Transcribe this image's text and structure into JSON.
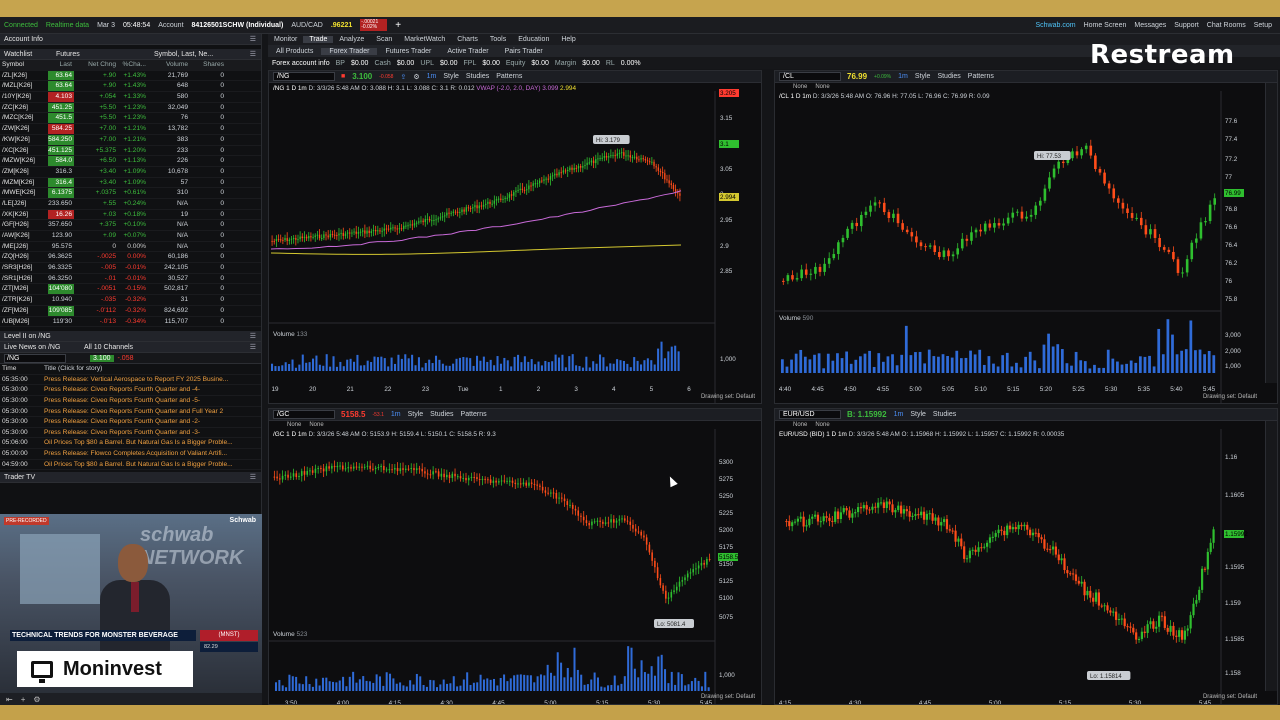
{
  "status": {
    "connected": "Connected",
    "realtime": "Realtime data",
    "date": "Mar 3",
    "time": "05:48:54",
    "account_label": "Account",
    "account": "84126501SCHW (Individual)",
    "audcad_sym": "AUD/CAD",
    "audcad_price": ".96221",
    "audcad_chg": "-.00021",
    "audcad_pct": "-0.02%",
    "schwab": "Schwab.com",
    "home": "Home Screen",
    "messages": "Messages",
    "support": "Support",
    "chat": "Chat Rooms",
    "setup": "Setup",
    "ondemand": "OnDemand"
  },
  "overlay": {
    "restream": "Restream",
    "moninvest": "Moninvest"
  },
  "left": {
    "account_info": "Account Info",
    "watchlist": "Watchlist",
    "watchlist_name": "Futures",
    "symbol_search": "Symbol, Last, Ne...",
    "cols": [
      "Symbol",
      "Last",
      "Net Chng",
      "%Cha...",
      "Volume",
      "Shares"
    ],
    "rows": [
      [
        "/ZL[K26]",
        "63.64",
        "+.90",
        "+1.43%",
        "21,769",
        "0",
        "up"
      ],
      [
        "/MZL[K26]",
        "63.64",
        "+.90",
        "+1.43%",
        "648",
        "0",
        "up"
      ],
      [
        "/10Y[K26]",
        "4.103",
        "+.054",
        "+1.33%",
        "580",
        "0",
        "dn"
      ],
      [
        "/ZC[K26]",
        "451.25",
        "+5.50",
        "+1.23%",
        "32,049",
        "0",
        "up"
      ],
      [
        "/MZC[K26]",
        "451.5",
        "+5.50",
        "+1.23%",
        "76",
        "0",
        "up"
      ],
      [
        "/ZW[K26]",
        "584.25",
        "+7.00",
        "+1.21%",
        "13,782",
        "0",
        "dn"
      ],
      [
        "/KW[K26]",
        "584.250",
        "+7.00",
        "+1.21%",
        "383",
        "0",
        "up"
      ],
      [
        "/XC[K26]",
        "451.125",
        "+5.375",
        "+1.20%",
        "233",
        "0",
        "up"
      ],
      [
        "/MZW[K26]",
        "584.0",
        "+6.50",
        "+1.13%",
        "226",
        "0",
        "up"
      ],
      [
        "/ZM[K26]",
        "316.3",
        "+3.40",
        "+1.09%",
        "10,678",
        "0",
        "none"
      ],
      [
        "/MZM[K26]",
        "316.4",
        "+3.40",
        "+1.09%",
        "57",
        "0",
        "up"
      ],
      [
        "/MWE[K26]",
        "6.1375",
        "+.0375",
        "+0.61%",
        "310",
        "0",
        "up"
      ],
      [
        "/LE[J26]",
        "233.650",
        "+.55",
        "+0.24%",
        "N/A",
        "0",
        "none"
      ],
      [
        "/XK[K26]",
        "16.26",
        "+.03",
        "+0.18%",
        "19",
        "0",
        "dn"
      ],
      [
        "/GF[H26]",
        "357.650",
        "+.375",
        "+0.10%",
        "N/A",
        "0",
        "none"
      ],
      [
        "/AW[K26]",
        "123.90",
        "+.09",
        "+0.07%",
        "N/A",
        "0",
        "none"
      ],
      [
        "/ME[J26]",
        "95.575",
        "0",
        "0.00%",
        "N/A",
        "0",
        "none"
      ],
      [
        "/ZQ[H26]",
        "96.3625",
        "-.0025",
        "0.00%",
        "60,186",
        "0",
        "none"
      ],
      [
        "/SR3[H26]",
        "96.3325",
        "-.005",
        "-0.01%",
        "242,105",
        "0",
        "none"
      ],
      [
        "/SR1[H26]",
        "96.3250",
        "-.01",
        "-0.01%",
        "30,527",
        "0",
        "none"
      ],
      [
        "/ZT[M26]",
        "104'080",
        "-.0051",
        "-0.15%",
        "502,817",
        "0",
        "up"
      ],
      [
        "/ZTR[K26]",
        "10.940",
        "-.035",
        "-0.32%",
        "31",
        "0",
        "none"
      ],
      [
        "/ZF[M26]",
        "109'085",
        "-.0'112",
        "-0.32%",
        "824,692",
        "0",
        "up"
      ],
      [
        "/UB[M26]",
        "119'30",
        "-.0'13",
        "-0.34%",
        "115,707",
        "0",
        "none"
      ]
    ],
    "level2": "Level II on /NG",
    "live_news": "Live News on /NG",
    "news_filter": "All 10 Channels",
    "news_sym": "/NG",
    "news_price": "3.100",
    "news_chg": "-.058",
    "news_cols": [
      "Time",
      "Title (Click for story)"
    ],
    "news": [
      [
        "05:35:00",
        "Press Release: Vertical Aerospace to Report FY 2025 Busine..."
      ],
      [
        "05:30:00",
        "Press Release: Civeo Reports Fourth Quarter and -4-"
      ],
      [
        "05:30:00",
        "Press Release: Civeo Reports Fourth Quarter and -5-"
      ],
      [
        "05:30:00",
        "Press Release: Civeo Reports Fourth Quarter and Full Year 2"
      ],
      [
        "05:30:00",
        "Press Release: Civeo Reports Fourth Quarter and -2-"
      ],
      [
        "05:30:00",
        "Press Release: Civeo Reports Fourth Quarter and -3-"
      ],
      [
        "05:06:00",
        "Oil Prices Top $80 a Barrel. But Natural Gas Is a Bigger Proble..."
      ],
      [
        "05:00:00",
        "Press Release: Flowco Completes Acquisition of Valiant Artifi..."
      ],
      [
        "04:59:00",
        "Oil Prices Top $80 a Barrel. But Natural Gas Is a Bigger Proble..."
      ]
    ],
    "trader_tv": "Trader TV",
    "tv": {
      "badge": "PRE-RECORDED",
      "logo": "Schwab",
      "sign": "schwab NETWORK",
      "caption": "TECHNICAL TRENDS FOR MONSTER BEVERAGE",
      "ticker": "(MNST)",
      "price": "82.29"
    }
  },
  "nav": {
    "tabs": [
      "Monitor",
      "Trade",
      "Analyze",
      "Scan",
      "MarketWatch",
      "Charts",
      "Tools",
      "Education",
      "Help"
    ],
    "active": 1,
    "subtabs": [
      "All Products",
      "Forex Trader",
      "Futures Trader",
      "Active Trader",
      "Pairs Trader"
    ],
    "forex_info": [
      [
        "Forex account info",
        ""
      ],
      [
        "BP",
        "$0.00"
      ],
      [
        "Cash",
        "$0.00"
      ],
      [
        "UPL",
        "$0.00"
      ],
      [
        "FPL",
        "$0.00"
      ],
      [
        "Equity",
        "$0.00"
      ],
      [
        "Margin",
        "$0.00"
      ],
      [
        "RL",
        "0.00%"
      ]
    ]
  },
  "common": {
    "style": "Style",
    "studies": "Studies",
    "patterns": "Patterns",
    "drawing": "Drawing set: Default",
    "none": "None",
    "volume": "Volume",
    "interval": "1m"
  },
  "charts": {
    "ng": {
      "sym": "/NG",
      "price": "3.100",
      "chg": "-0.058",
      "info": "/NG 1 D 1m",
      "date": "D: 3/3/26 5:48 AM",
      "o": "O: 3.088",
      "h": "H: 3.1",
      "l": "L: 3.088",
      "c": "C: 3.1",
      "r": "R: 0.012",
      "vwap": "VWAP (-2.0, 2.0, DAY)",
      "vwap1": "3.099",
      "vwap2": "2.994",
      "hi": "Hi: 3.179",
      "vol": "133",
      "yt": [
        "3.205",
        "3.15",
        "3.1",
        "3.05",
        "3",
        "2.994",
        "2.95",
        "2.9",
        "2.85"
      ],
      "vt": [
        "1,000"
      ],
      "xt": [
        "19",
        "20",
        "21",
        "22",
        "23",
        "Tue",
        "1",
        "2",
        "3",
        "4",
        "5",
        "6"
      ]
    },
    "cl": {
      "sym": "/CL",
      "price": "76.99",
      "chg": "+0.09%",
      "info": "/CL 1 D 1m",
      "date": "D: 3/3/26 5:48 AM",
      "o": "O: 76.96",
      "h": "H: 77.05",
      "l": "L: 76.96",
      "c": "C: 76.99",
      "r": "R: 0.09",
      "hi": "Hi: 77.53",
      "vol": "590",
      "yt": [
        "77.6",
        "77.4",
        "77.2",
        "77",
        "76.99",
        "76.8",
        "76.6",
        "76.4",
        "76.2",
        "76",
        "75.8"
      ],
      "vt": [
        "3,000",
        "2,000",
        "1,000"
      ],
      "xt": [
        "4:40",
        "4:45",
        "4:50",
        "4:55",
        "5:00",
        "5:05",
        "5:10",
        "5:15",
        "5:20",
        "5:25",
        "5:30",
        "5:35",
        "5:40",
        "5:45"
      ]
    },
    "gc": {
      "sym": "/GC",
      "price": "5158.5",
      "chg": "-53.1",
      "info": "/GC 1 D 1m",
      "date": "D: 3/3/26 5:48 AM",
      "o": "O: 5153.9",
      "h": "H: 5159.4",
      "l": "L: 5150.1",
      "c": "C: 5158.5",
      "r": "R: 9.3",
      "lo": "Lo: 5081.4",
      "vol": "523",
      "yt": [
        "5300",
        "5275",
        "5250",
        "5225",
        "5200",
        "5175",
        "5158.5",
        "5150",
        "5125",
        "5100",
        "5075"
      ],
      "vt": [
        "1,000"
      ],
      "xt": [
        "3:50",
        "4:00",
        "4:15",
        "4:30",
        "4:45",
        "5:00",
        "5:15",
        "5:30",
        "5:45"
      ]
    },
    "eur": {
      "sym": "EUR/USD",
      "price": "B: 1.15992",
      "info": "EUR/USD (BID) 1 D 1m",
      "date": "D: 3/3/26 5:48 AM",
      "o": "O: 1.15968",
      "h": "H: 1.15992",
      "l": "L: 1.15957",
      "c": "C: 1.15992",
      "r": "R: 0.00035",
      "lo": "Lo: 1.15814",
      "yt": [
        "1.16",
        "1.1605",
        "1.15992",
        "1.1595",
        "1.159",
        "1.1585",
        "1.158"
      ],
      "xt": [
        "4:15",
        "4:30",
        "4:45",
        "5:00",
        "5:15",
        "5:30",
        "5:45"
      ]
    }
  },
  "colors": {
    "up": "#2fbf2f",
    "down": "#ff4d1a",
    "vwap": "#c86ad8",
    "band": "#d4c830",
    "vol": "#2f6bd8"
  }
}
